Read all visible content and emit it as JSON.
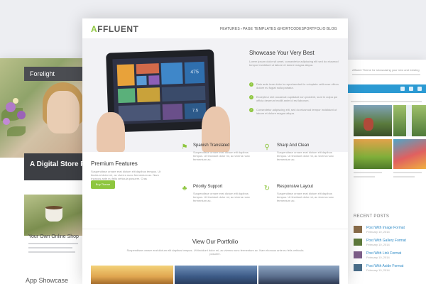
{
  "left_theme": {
    "brand": "Forelight",
    "banner": "A Digital Store Fo",
    "shop_title": "Your Own Online Shop",
    "section_title": "App Showcase"
  },
  "right_theme": {
    "intro": "Affluent Theme for showcasing your new and existing",
    "recent_posts_label": "RECENT POSTS",
    "posts": [
      {
        "title": "Post With Image Format",
        "date": "February 10, 2014"
      },
      {
        "title": "Post With Gallery Format",
        "date": "February 10, 2014"
      },
      {
        "title": "Post With Link Format",
        "date": "February 10, 2014"
      },
      {
        "title": "Post With Aside Format",
        "date": "February 10, 2014"
      }
    ]
  },
  "main_theme": {
    "logo_accent": "A",
    "logo_rest": "FFLUENT",
    "nav": [
      "FEATURES",
      "PAGE TEMPLATES",
      "SHORTCODES",
      "PORTFOLIO",
      "BLOG"
    ],
    "hero": {
      "title": "Showcase Your Very Best",
      "text": "Lorem ipsum dolor sit amet, consectetur adipiscing elit sed do eiusmod tempor incididunt ut labore et dolore magna aliqua.",
      "checks": [
        "Duis aute irure dolor in reprehenderit in voluptate velit esse cillum dolore eu fugiat nulla pariatur.",
        "Excepteur sint occaecat cupidatat non proident, sunt in culpa qui officia deserunt mollit anim id est laborum.",
        "Consectetur adipiscing elit, sed do eiusmod tempor incididunt ut labore et dolore magna aliqua."
      ]
    },
    "premium": {
      "title": "Premium Features",
      "text": "Suspendisse ornare erat dictum elit dapibus tempus. Ut tincidunt dolor mi, ac viverra nunc fermentum ac. Nam rhoncus ante eu felis vehicula posuere. Cras pellentesque felis.",
      "button": "Buy Theme"
    },
    "features": [
      {
        "icon": "flag-icon",
        "title": "Spanish Translated",
        "text": "Suspendisse ornare erat dictum elit dapibus tempus. Ut tincidunt dolor mi, ac viverra nunc fermentum ac."
      },
      {
        "icon": "pin-icon",
        "title": "Sharp And Clean",
        "text": "Suspendisse ornare erat dictum elit dapibus tempus. Ut tincidunt dolor mi, ac viverra nunc fermentum ac."
      },
      {
        "icon": "support-icon",
        "title": "Priority Support",
        "text": "Suspendisse ornare erat dictum elit dapibus tempus. Ut tincidunt dolor mi, ac viverra nunc fermentum ac."
      },
      {
        "icon": "refresh-icon",
        "title": "Responsive Layout",
        "text": "Suspendisse ornare erat dictum elit dapibus tempus. Ut tincidunt dolor mi, ac viverra nunc fermentum ac."
      }
    ],
    "portfolio": {
      "title": "View Our Portfolio",
      "text": "Suspendisse ornare erat dictum elit dapibus tempus. Ut tincidunt dolor mi, ac viverra nunc fermentum ac. Nam rhoncus ante eu felis vehicula posuere."
    },
    "tablet_numbers": [
      "475",
      "7.5"
    ]
  },
  "colors": {
    "accent_green": "#8ec63f",
    "right_bar_blue": "#2b9ad3",
    "dark_banner": "#3d3f44"
  }
}
